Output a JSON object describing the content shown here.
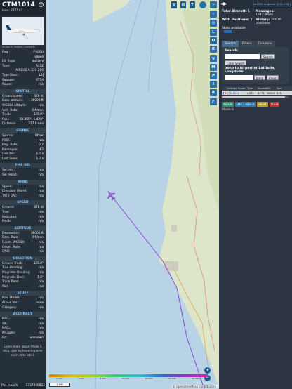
{
  "left": {
    "callsign": "CTM1014",
    "hex_label": "Hex:",
    "hex": "3B7542",
    "image_credit": "Image © Mateus Lamberts",
    "rows1": [
      {
        "k": "Reg.:",
        "v": "F-UJCU"
      },
      {
        "k": "",
        "v": "France"
      },
      {
        "k": "DB flags:",
        "v": "military"
      },
      {
        "k": "Type:",
        "v": "A332"
      },
      {
        "k": "",
        "v": "AIRBUS A-330-200"
      },
      {
        "k": "Type Desc.:",
        "v": "L2J"
      },
      {
        "k": "Squawk:",
        "v": "6774"
      },
      {
        "k": "Route:",
        "v": "n/a"
      }
    ],
    "sec_spatial": "SPATIAL",
    "spatial": [
      {
        "k": "Groundspeed:",
        "v": "476 kt"
      },
      {
        "k": "Baro. altitude:",
        "v": "36000 ft"
      },
      {
        "k": "WGS84 altitude:",
        "v": "n/a"
      },
      {
        "k": "Vert. Rate:",
        "v": "0 ft/min"
      },
      {
        "k": "Track:",
        "v": "325.0°"
      },
      {
        "k": "Pos.:",
        "v": "50.855°, 1.428°"
      },
      {
        "k": "Distance:",
        "v": "217.0 nmi"
      }
    ],
    "sec_signal": "SIGNAL",
    "signal": [
      {
        "k": "Source:",
        "v": "Other"
      },
      {
        "k": "RSSI:",
        "v": "n/a"
      },
      {
        "k": "Msg. Rate:",
        "v": "0.7"
      },
      {
        "k": "Messages:",
        "v": "82"
      },
      {
        "k": "Last Pos.:",
        "v": "1.7 s"
      },
      {
        "k": "Last Seen:",
        "v": "1.7 s"
      }
    ],
    "sec_fms": "FMS SEL",
    "fms": [
      {
        "k": "Sel. Alt.:",
        "v": "n/a"
      },
      {
        "k": "Sel. Head.:",
        "v": "n/a"
      }
    ],
    "sec_wind": "WIND",
    "wind": [
      {
        "k": "Speed:",
        "v": "n/a"
      },
      {
        "k": "Direction (from):",
        "v": "n/a"
      },
      {
        "k": "TAT / OAT:",
        "v": "n/a"
      }
    ],
    "sec_speed": "SPEED",
    "speed": [
      {
        "k": "Ground:",
        "v": "476 kt"
      },
      {
        "k": "True:",
        "v": "n/a"
      },
      {
        "k": "Indicated:",
        "v": "n/a"
      },
      {
        "k": "Mach:",
        "v": "n/a"
      }
    ],
    "sec_alt": "ALTITUDE",
    "alt": [
      {
        "k": "Barometric:",
        "v": "36000 ft"
      },
      {
        "k": "Baro. Rate:",
        "v": "0 ft/min"
      },
      {
        "k": "Geom. WGS84:",
        "v": "n/a"
      },
      {
        "k": "Geom. Rate:",
        "v": "n/a"
      },
      {
        "k": "QNH:",
        "v": "n/a"
      }
    ],
    "sec_dir": "DIRECTION",
    "dir": [
      {
        "k": "Ground Track:",
        "v": "325.0°"
      },
      {
        "k": "True Heading:",
        "v": "n/a"
      },
      {
        "k": "Magnetic Heading:",
        "v": "n/a"
      },
      {
        "k": "Magnetic Decl.:",
        "v": "1.8°"
      },
      {
        "k": "Track Rate:",
        "v": "n/a"
      },
      {
        "k": "Roll:",
        "v": "n/a"
      }
    ],
    "sec_stuff": "STUFF",
    "stuff": [
      {
        "k": "Nav. Modes:",
        "v": "n/a"
      },
      {
        "k": "ADS-B Ver.:",
        "v": "none"
      },
      {
        "k": "Category:",
        "v": "n/a"
      }
    ],
    "sec_acc": "ACCURACY",
    "acc": [
      {
        "k": "NACₚ:",
        "v": "n/a"
      },
      {
        "k": "SIL:",
        "v": "n/a"
      },
      {
        "k": "NACᵥ:",
        "v": "n/a"
      },
      {
        "k": "NICʙᴀʀᴏ:",
        "v": "n/a"
      },
      {
        "k": "Rc:",
        "v": "unknown"
      }
    ],
    "note": "Learn more about Mode S data type by hovering over each data label.",
    "pos_epoch_label": "Pos. epoch:",
    "pos_epoch": "1737966822"
  },
  "map": {
    "top_buttons": [
      "U",
      "H",
      "T"
    ],
    "right_buttons": [
      "L",
      "O",
      "K",
      "V",
      "M",
      "P",
      "I",
      "R",
      "F"
    ],
    "colorbar_ticks": [
      "2 000",
      "4 000",
      "6 000",
      "10 000",
      "20 000",
      "30 000",
      "40 000+"
    ],
    "scale_label": "2 NM",
    "attribution": "© OpenStreetMap contributors.",
    "zoom_in": "+",
    "zoom_out": "−",
    "colors": {
      "sea": "#b9d3e6",
      "land": "#dde6c8",
      "track": "#8a4dd6",
      "aircraft": "#b05ce6"
    }
  },
  "right": {
    "nav_arrows": "◀▶",
    "link": "tar1090 on github (3.14.1701)",
    "total_label": "Total Aircraft:",
    "total": "1",
    "messages_label": "Messages:",
    "messages": "1342.9/sec",
    "withpos_label": "With Positions:",
    "withpos": "1",
    "history_label": "History:",
    "history": "24030 positions",
    "stats_label": "Stats available",
    "tabs": [
      "Search",
      "Filters",
      "Columns"
    ],
    "search_label": "Search:",
    "search_placeholder": "",
    "search_btn": "Search",
    "clear_search": "Clear Search",
    "jump_label": "Jump to Airport or Latitude, Longitude:",
    "jump_btn": "Jump",
    "clear_btn": "Clear",
    "table_headers": [
      "",
      "Callsign",
      "Route",
      "Type",
      "Squawk",
      "Alt.",
      "Spd."
    ],
    "table_row": {
      "flag": "🇫🇷",
      "callsign": "CTM1014",
      "route": "",
      "type": "A332",
      "squawk": "6774",
      "alt": "36000",
      "spd": "476"
    },
    "source_badges": [
      "ADS-B",
      "UAT / ADS-R",
      "MLAT",
      "TIS-B"
    ],
    "mode_s": "Mode-S"
  }
}
